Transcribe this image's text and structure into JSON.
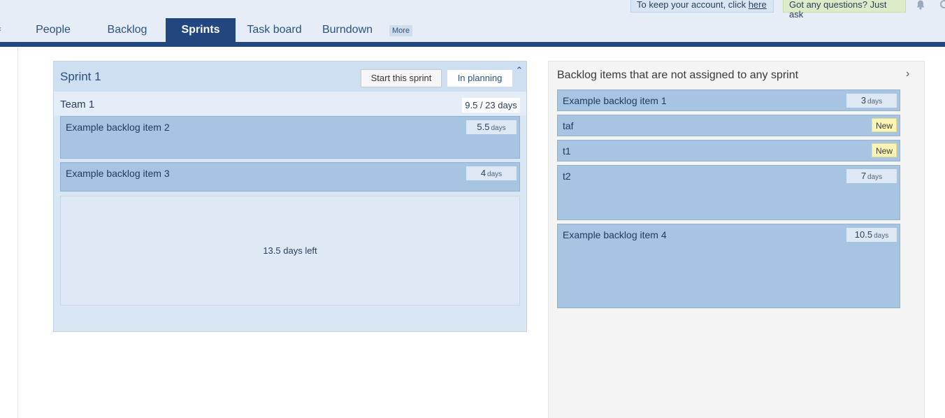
{
  "nav": {
    "tabs": [
      {
        "label": "People"
      },
      {
        "label": "Backlog"
      },
      {
        "label": "Sprints"
      },
      {
        "label": "Task board"
      },
      {
        "label": "Burndown"
      }
    ],
    "more_label": "More",
    "edge_glyph": "‹"
  },
  "notices": {
    "account_text": "To keep your account, click ",
    "account_link": "here",
    "questions": "Got any questions? Just ask"
  },
  "sprint": {
    "title": "Sprint 1",
    "start_label": "Start this sprint",
    "status_label": "In planning",
    "team": {
      "label": "Team 1",
      "capacity": "9.5 / 23 days"
    },
    "items": [
      {
        "title": "Example backlog item 2",
        "estimate": "5.5",
        "unit": "days"
      },
      {
        "title": "Example backlog item 3",
        "estimate": "4",
        "unit": "days"
      }
    ],
    "days_left": "13.5 days left"
  },
  "unassigned": {
    "title": "Backlog items that are not assigned to any sprint",
    "items": [
      {
        "title": "Example backlog item 1",
        "estimate": "3",
        "unit": "days"
      },
      {
        "title": "taf",
        "badge": "New"
      },
      {
        "title": "t1",
        "badge": "New"
      },
      {
        "title": "t2",
        "estimate": "7",
        "unit": "days"
      },
      {
        "title": "Example backlog item 4",
        "estimate": "10.5",
        "unit": "days"
      }
    ]
  }
}
